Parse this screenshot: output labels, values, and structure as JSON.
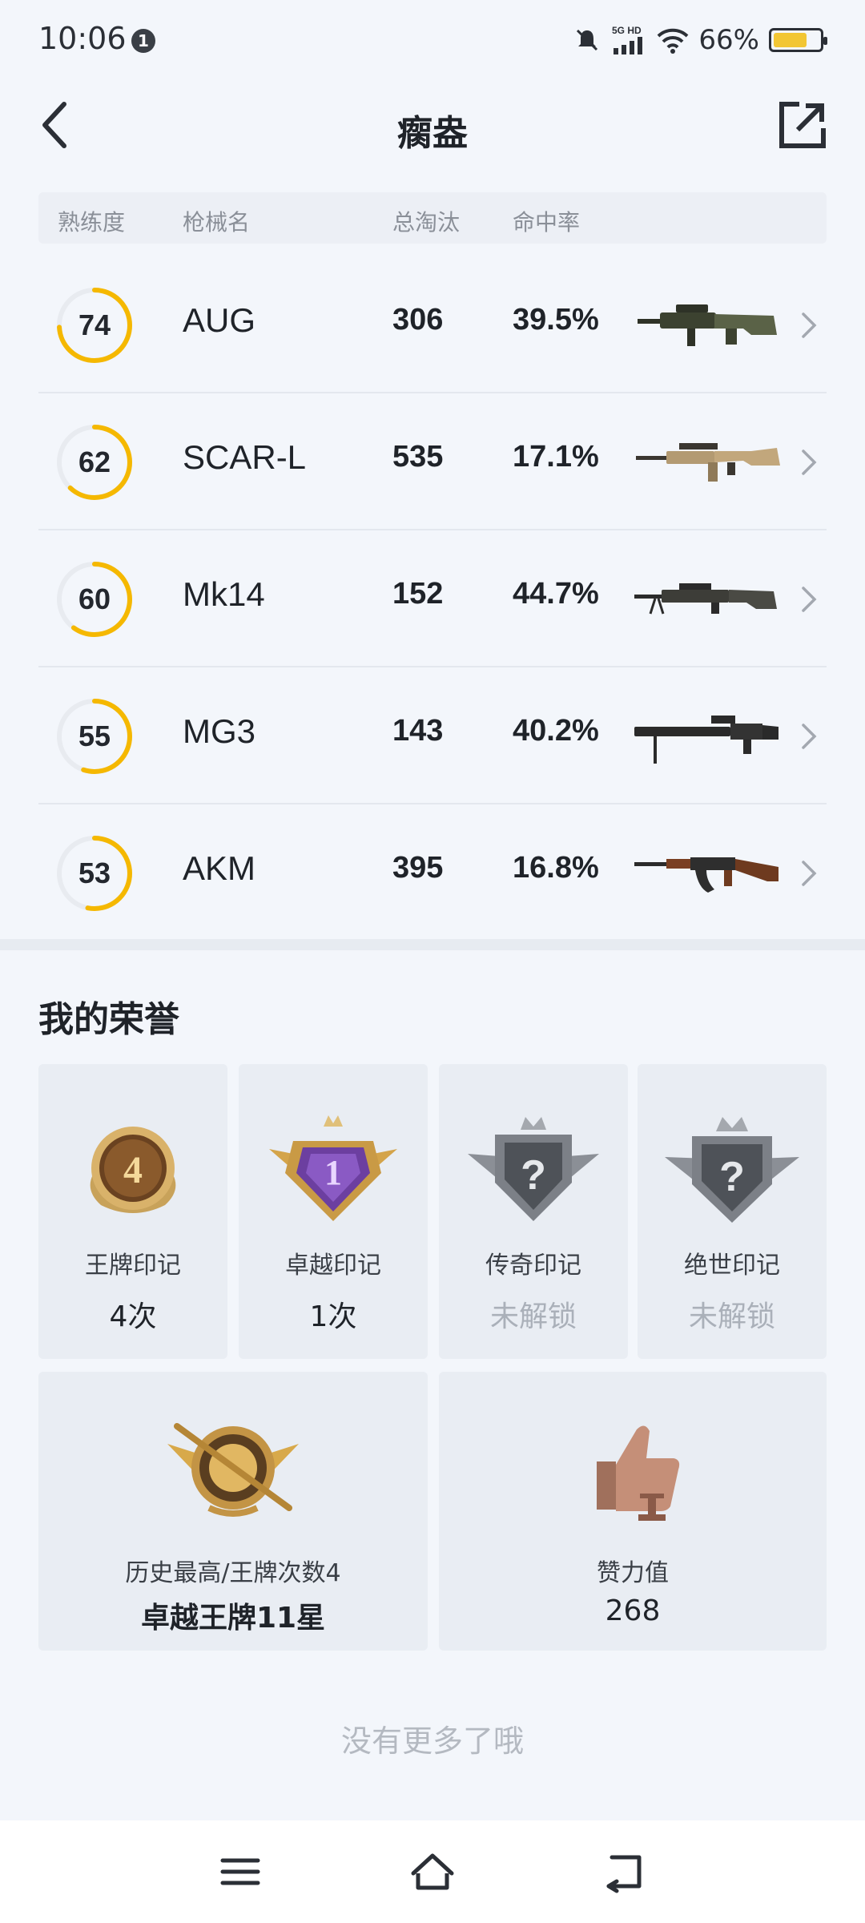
{
  "status_bar": {
    "time": "10:06",
    "notification_count": "1",
    "network": "5G HD",
    "battery_percent": "66%",
    "battery_level": 0.66
  },
  "header": {
    "title": "瘸盎"
  },
  "table": {
    "headers": {
      "proficiency": "熟练度",
      "weapon_name": "枪械名",
      "total_kills": "总淘汰",
      "hit_rate": "命中率"
    },
    "rows": [
      {
        "proficiency": "74",
        "proficiency_fraction": 0.74,
        "name": "AUG",
        "kills": "306",
        "hit_rate": "39.5%",
        "gun_icon": "aug-rifle-icon"
      },
      {
        "proficiency": "62",
        "proficiency_fraction": 0.62,
        "name": "SCAR-L",
        "kills": "535",
        "hit_rate": "17.1%",
        "gun_icon": "scar-rifle-icon"
      },
      {
        "proficiency": "60",
        "proficiency_fraction": 0.6,
        "name": "Mk14",
        "kills": "152",
        "hit_rate": "44.7%",
        "gun_icon": "mk14-rifle-icon"
      },
      {
        "proficiency": "55",
        "proficiency_fraction": 0.55,
        "name": "MG3",
        "kills": "143",
        "hit_rate": "40.2%",
        "gun_icon": "mg3-gun-icon"
      },
      {
        "proficiency": "53",
        "proficiency_fraction": 0.53,
        "name": "AKM",
        "kills": "395",
        "hit_rate": "16.8%",
        "gun_icon": "akm-rifle-icon"
      }
    ]
  },
  "honors": {
    "title": "我的荣誉",
    "badges": [
      {
        "label": "王牌印记",
        "value": "4次",
        "badge_number": "4",
        "locked": false
      },
      {
        "label": "卓越印记",
        "value": "1次",
        "badge_number": "1",
        "locked": false
      },
      {
        "label": "传奇印记",
        "value": "未解锁",
        "badge_number": "?",
        "locked": true
      },
      {
        "label": "绝世印记",
        "value": "未解锁",
        "badge_number": "?",
        "locked": true
      }
    ],
    "highest": {
      "label": "历史最高/王牌次数4",
      "value": "卓越王牌11星"
    },
    "likes": {
      "label": "赞力值",
      "value": "268"
    }
  },
  "footer_text": "没有更多了哦",
  "colors": {
    "accent_ring": "#f5b800",
    "ring_track": "#e8ebf0",
    "background": "#f3f6fb"
  }
}
